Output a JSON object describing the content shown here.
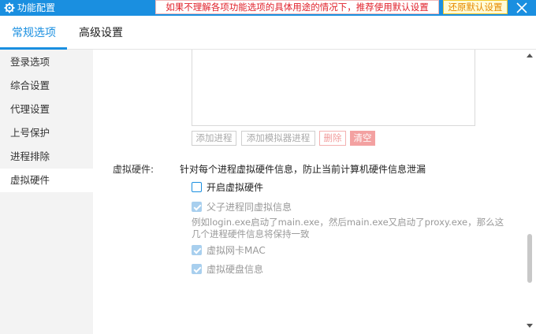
{
  "window": {
    "title": "功能配置",
    "warning": "如果不理解各项功能选项的具体用途的情况下，推荐使用默认设置",
    "restore_label": "还原默认设置"
  },
  "tabs": [
    {
      "label": "常规选项",
      "active": true
    },
    {
      "label": "高级设置",
      "active": false
    }
  ],
  "sidebar": {
    "items": [
      {
        "label": "登录选项",
        "active": false
      },
      {
        "label": "综合设置",
        "active": false
      },
      {
        "label": "代理设置",
        "active": false
      },
      {
        "label": "上号保护",
        "active": false
      },
      {
        "label": "进程排除",
        "active": false
      },
      {
        "label": "虚拟硬件",
        "active": true
      }
    ]
  },
  "process_buttons": {
    "add_process": "添加进程",
    "add_emulator_process": "添加模拟器进程",
    "delete": "删除",
    "clear": "清空"
  },
  "virtual_hardware": {
    "label": "虚拟硬件:",
    "description": "针对每个进程虚拟硬件信息，防止当前计算机硬件信息泄漏",
    "enable": {
      "label": "开启虚拟硬件",
      "checked": false
    },
    "parent_child": {
      "label": "父子进程同虚拟信息",
      "checked": true,
      "disabled": true
    },
    "note": "例如login.exe启动了main.exe，然后main.exe又启动了proxy.exe，那么这几个进程硬件信息将保持一致",
    "nic_mac": {
      "label": "虚拟网卡MAC",
      "checked": true,
      "disabled": true
    },
    "disk": {
      "label": "虚拟硬盘信息",
      "checked": true,
      "disabled": true
    }
  },
  "colors": {
    "accent": "#1a8fe0",
    "warning_text": "#e0202a",
    "restore_text": "#e68a00",
    "sidebar_bg": "#f3f3f3"
  }
}
